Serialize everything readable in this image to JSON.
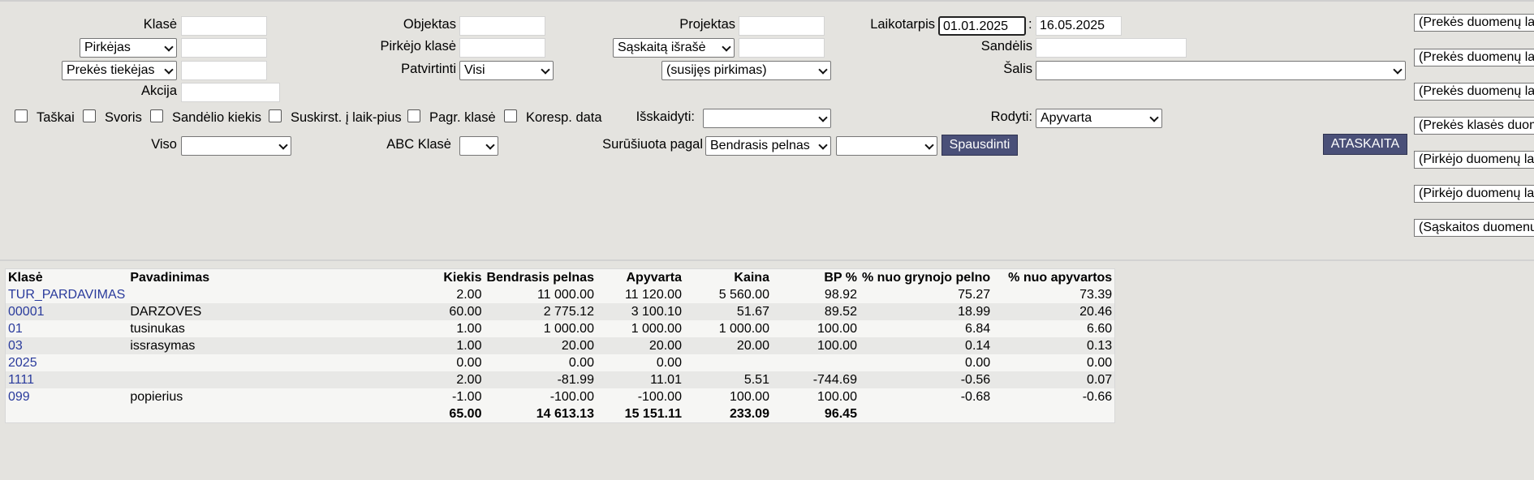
{
  "filters": {
    "klase_label": "Klasė",
    "pirkejas_select": "Pirkėjas",
    "tiekejas_select": "Prekės tiekėjas",
    "akcija_label": "Akcija",
    "objektas_label": "Objektas",
    "pirkejo_klase_label": "Pirkėjo klasė",
    "patvirtinti_label": "Patvirtinti",
    "patvirtinti_value": "Visi",
    "projektas_label": "Projektas",
    "saskaita_select": "Sąskaitą išrašė",
    "susijes_select": "(susijęs pirkimas)",
    "laikotarpis_label": "Laikotarpis",
    "date_from": "01.01.2025",
    "date_sep": ":",
    "date_to": "16.05.2025",
    "sandelis_label": "Sandėlis",
    "salis_label": "Šalis",
    "iskaidyti_label": "Išskaidyti:",
    "rodyti_label": "Rodyti:",
    "rodyti_value": "Apyvarta",
    "viso_label": "Viso",
    "abc_label": "ABC Klasė",
    "surusiuota_label": "Surūšiuota pagal",
    "surusiuota_value": "Bendrasis pelnas",
    "print_button": "Spausdinti",
    "report_button": "ATASKAITA",
    "checkboxes": [
      "Taškai",
      "Svoris",
      "Sandėlio kiekis",
      "Suskirst. į laik-pius",
      "Pagr. klasė",
      "Koresp. data"
    ]
  },
  "right_panel": [
    "(Prekės duomenų la",
    "(Prekės duomenų la",
    "(Prekės duomenų la",
    "(Prekės klasės duom",
    "(Pirkėjo duomenų la",
    "(Pirkėjo duomenų la",
    "(Sąskaitos duomenu"
  ],
  "table": {
    "headers": [
      "Klasė",
      "Pavadinimas",
      "Kiekis",
      "Bendrasis pelnas",
      "Apyvarta",
      "Kaina",
      "BP %",
      "% nuo grynojo pelno",
      "% nuo apyvartos"
    ],
    "rows": [
      [
        "TUR_PARDAVIMAS",
        "",
        "2.00",
        "11 000.00",
        "11 120.00",
        "5 560.00",
        "98.92",
        "75.27",
        "73.39"
      ],
      [
        "00001",
        "DARZOVES",
        "60.00",
        "2 775.12",
        "3 100.10",
        "51.67",
        "89.52",
        "18.99",
        "20.46"
      ],
      [
        "01",
        "tusinukas",
        "1.00",
        "1 000.00",
        "1 000.00",
        "1 000.00",
        "100.00",
        "6.84",
        "6.60"
      ],
      [
        "03",
        "issrasymas",
        "1.00",
        "20.00",
        "20.00",
        "20.00",
        "100.00",
        "0.14",
        "0.13"
      ],
      [
        "2025",
        "",
        "0.00",
        "0.00",
        "0.00",
        "",
        "",
        "0.00",
        "0.00"
      ],
      [
        "1111",
        "",
        "2.00",
        "-81.99",
        "11.01",
        "5.51",
        "-744.69",
        "-0.56",
        "0.07"
      ],
      [
        "099",
        "popierius",
        "-1.00",
        "-100.00",
        "-100.00",
        "100.00",
        "100.00",
        "-0.68",
        "-0.66"
      ]
    ],
    "totals": [
      "",
      "",
      "65.00",
      "14 613.13",
      "15 151.11",
      "233.09",
      "96.45",
      "",
      ""
    ]
  }
}
